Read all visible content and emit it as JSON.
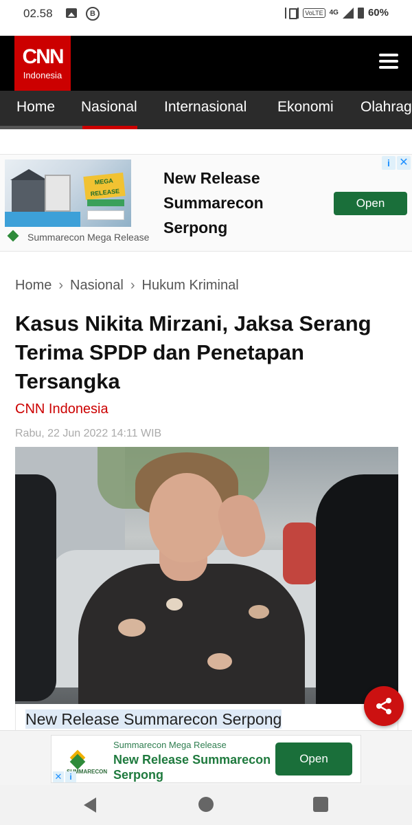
{
  "status_bar": {
    "time": "02.58",
    "network": "4G",
    "volte": "VoLTE",
    "battery": "60%"
  },
  "header": {
    "logo_main": "CNN",
    "logo_sub": "Indonesia"
  },
  "nav": {
    "items": [
      "Home",
      "Nasional",
      "Internasional",
      "Ekonomi",
      "Olahraga"
    ],
    "active": "Nasional"
  },
  "ad_top": {
    "badge": "MEGA RELEASE",
    "headline": "New Release Summarecon Serpong",
    "advertiser": "Summarecon Mega Release",
    "cta": "Open",
    "info_icon": "i",
    "close_icon": "✕"
  },
  "breadcrumb": {
    "items": [
      "Home",
      "Nasional",
      "Hukum Kriminal"
    ],
    "separator": "›"
  },
  "article": {
    "title": "Kasus Nikita Mirzani, Jaksa Serang Terima SPDP dan Penetapan Tersangka",
    "author": "CNN Indonesia",
    "date": "Rabu, 22 Jun 2022 14:11 WIB"
  },
  "inline_caption": {
    "text": "New Release Summarecon Serpong"
  },
  "ad_bottom": {
    "brand_small": "SUMMARECON",
    "advertiser": "Summarecon Mega Release",
    "headline": "New Release Summarecon Serpong",
    "cta": "Open",
    "close_icon": "✕",
    "info_icon": "i"
  },
  "colors": {
    "brand_red": "#cc0000",
    "nav_bg": "#2b2b2b",
    "ad_green": "#1a6f3a"
  }
}
